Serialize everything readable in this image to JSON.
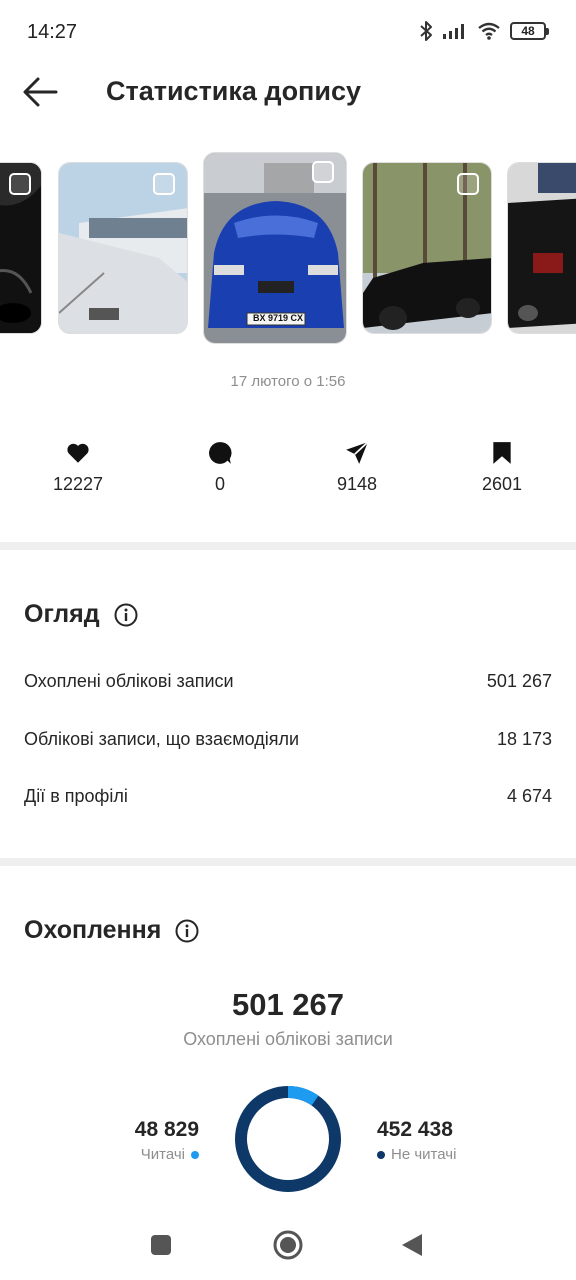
{
  "status_bar": {
    "time": "14:27",
    "battery": "48"
  },
  "header": {
    "title": "Статистика допису"
  },
  "carousel": {
    "items": [
      {
        "name": "thumb-black-car"
      },
      {
        "name": "thumb-yacht"
      },
      {
        "name": "thumb-blue-bmw",
        "plate": "BX 9719 CX"
      },
      {
        "name": "thumb-black-hearse"
      },
      {
        "name": "thumb-black-suv"
      }
    ]
  },
  "post": {
    "date": "17 лютого о 1:56"
  },
  "metrics": {
    "likes": "12227",
    "comments": "0",
    "shares": "9148",
    "saves": "2601"
  },
  "overview": {
    "title": "Огляд",
    "rows": [
      {
        "label": "Охоплені облікові записи",
        "value": "501 267"
      },
      {
        "label": "Облікові записи, що взаємодіяли",
        "value": "18 173"
      },
      {
        "label": "Дії в профілі",
        "value": "4 674"
      }
    ]
  },
  "reach": {
    "title": "Охоплення",
    "total": "501 267",
    "subtitle": "Охоплені облікові записи",
    "followers": {
      "value": "48 829",
      "label": "Читачі",
      "count": 48829,
      "color": "#1d9bf0"
    },
    "non_followers": {
      "value": "452 438",
      "label": "Не читачі",
      "count": 452438,
      "color": "#0d3868"
    }
  }
}
